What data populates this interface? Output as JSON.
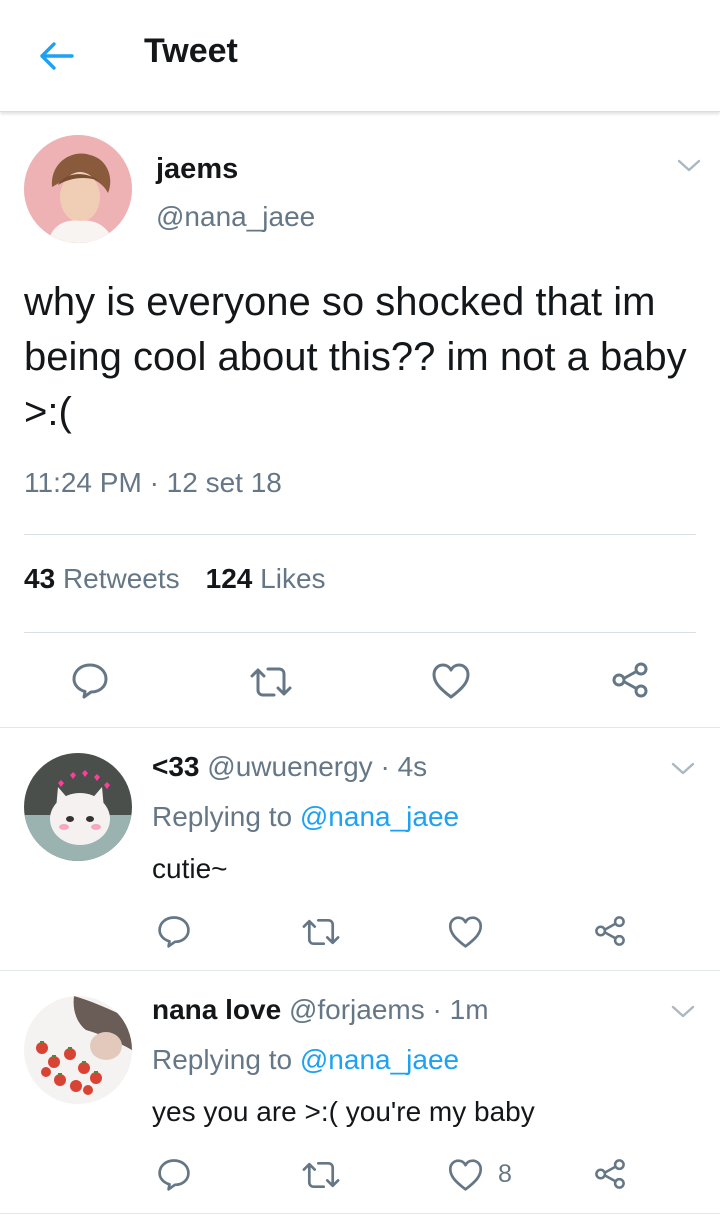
{
  "header": {
    "title": "Tweet",
    "back_icon": "arrow-left-icon",
    "accent": "#1da1f2"
  },
  "tweet": {
    "author_name": "jaems",
    "author_handle": "@nana_jaee",
    "text": "why is everyone so shocked that im being cool about this?? im not a baby >:(",
    "time": "11:24 PM",
    "separator": "·",
    "date": "12 set 18",
    "retweets_count": "43",
    "retweets_label": "Retweets",
    "likes_count": "124",
    "likes_label": "Likes",
    "actions": [
      "reply-icon",
      "retweet-icon",
      "like-icon",
      "share-icon"
    ]
  },
  "replies": [
    {
      "name": "<33",
      "handle": "@uwuenergy",
      "separator": "·",
      "age": "4s",
      "replying_prefix": "Replying to",
      "replying_to": "@nana_jaee",
      "text": "cutie~",
      "like_count": ""
    },
    {
      "name": "nana love",
      "handle": "@forjaems",
      "separator": "·",
      "age": "1m",
      "replying_prefix": "Replying to",
      "replying_to": "@nana_jaee",
      "text": "yes you are >:( you're my baby",
      "like_count": "8"
    }
  ],
  "colors": {
    "secondary_text": "#657786",
    "primary_text": "#14171a",
    "icon": "#657786",
    "divider": "#e1e8ed"
  }
}
